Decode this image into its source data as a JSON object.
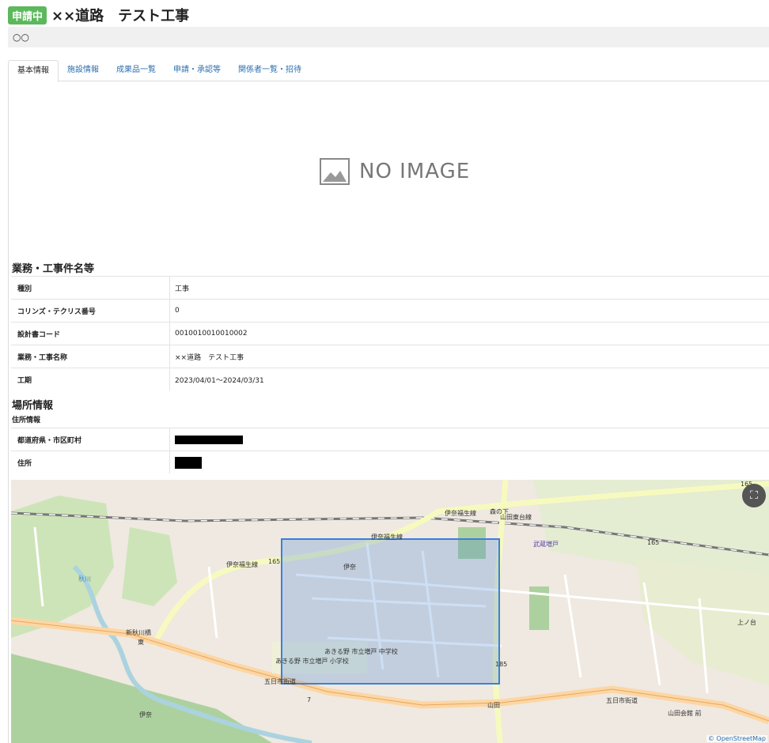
{
  "header": {
    "badge": "申請中",
    "title": "××道路　テスト工事",
    "subtitle": "○○"
  },
  "tabs": [
    "基本情報",
    "施設情報",
    "成果品一覧",
    "申請・承認等",
    "関係者一覧・招待"
  ],
  "no_image_label": "NO IMAGE",
  "section_project": {
    "title": "業務・工事件名等",
    "rows": [
      {
        "label": "種別",
        "value": "工事"
      },
      {
        "label": "コリンズ・テクリス番号",
        "value": "0"
      },
      {
        "label": "設計書コード",
        "value": "0010010010010002"
      },
      {
        "label": "業務・工事名称",
        "value": "××道路　テスト工事"
      },
      {
        "label": "工期",
        "value": "2023/04/01～2024/03/31"
      }
    ]
  },
  "section_location": {
    "title": "場所情報",
    "subtitle": "住所情報",
    "rows": [
      {
        "label": "都道府県・市区町村"
      },
      {
        "label": "住所"
      }
    ]
  },
  "map": {
    "labels": [
      "伊奈福生線",
      "伊奈福生線",
      "伊奈福生線",
      "森の下",
      "山田東台線",
      "武蔵増戸",
      "伊奈",
      "新秋川橋",
      "東",
      "五日市街道",
      "五日市街道",
      "あきる野 市立増戸 中学校",
      "あきる野 市立増戸 小学校",
      "山田",
      "山田会館 前",
      "上ノ台",
      "165",
      "165",
      "165",
      "185",
      "7",
      "秋川",
      "伊奈"
    ],
    "credit": "© OpenStreetMap",
    "selection_color": "#3d7fd9"
  },
  "colors": {
    "badge": "#5cb85c",
    "link": "#2a6fb0"
  }
}
